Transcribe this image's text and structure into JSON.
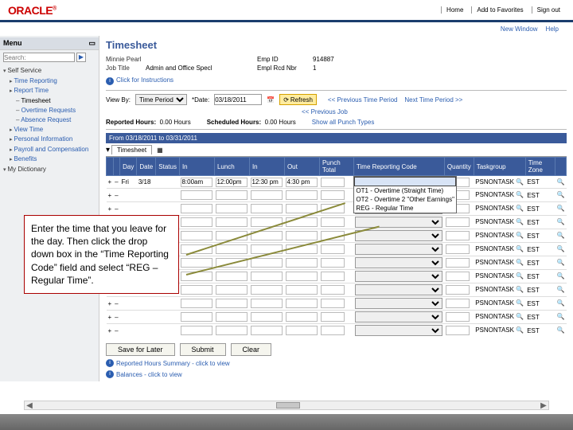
{
  "brand": "ORACLE",
  "top_links": [
    "Home",
    "Add to Favorites",
    "Sign out"
  ],
  "sub_header": {
    "new_window": "New Window",
    "help": "Help"
  },
  "sidebar": {
    "menu_label": "Menu",
    "search_placeholder": "Search:",
    "items": [
      {
        "cls": "lvl0",
        "t": "Self Service"
      },
      {
        "cls": "lvl1",
        "t": "Time Reporting"
      },
      {
        "cls": "lvl1",
        "t": "Report Time"
      },
      {
        "cls": "lvl2 active",
        "t": "Timesheet"
      },
      {
        "cls": "lvl2",
        "t": "Overtime Requests"
      },
      {
        "cls": "lvl2",
        "t": "Absence Request"
      },
      {
        "cls": "lvl1",
        "t": "View Time"
      },
      {
        "cls": "lvl1",
        "t": "Personal Information"
      },
      {
        "cls": "lvl1",
        "t": "Payroll and Compensation"
      },
      {
        "cls": "lvl1",
        "t": "Benefits"
      },
      {
        "cls": "lvl0",
        "t": "My Dictionary"
      }
    ]
  },
  "page": {
    "title": "Timesheet",
    "name": "Minnie Pearl",
    "job_title_lbl": "Job Title",
    "job_title": "Admin and Office Specl",
    "emp_id_lbl": "Emp ID",
    "emp_id": "914887",
    "emp_rcd_lbl": "Empl Rcd Nbr",
    "emp_rcd": "1",
    "instr": "Click for Instructions",
    "view_by_lbl": "View By:",
    "view_by": "Time Period",
    "date_lbl": "*Date:",
    "date": "03/18/2011",
    "refresh": "Refresh",
    "prev_period": "<< Previous Time Period",
    "next_period": "Next Time Period >>",
    "prev_job": "<< Previous Job",
    "rep_hours_lbl": "Reported Hours:",
    "rep_hours": "0.00 Hours",
    "sched_hours_lbl": "Scheduled Hours:",
    "sched_hours": "0.00 Hours",
    "show_all": "Show all Punch Types",
    "band": "From 03/18/2011 to 03/31/2011",
    "tab": "Timesheet",
    "cols": [
      "",
      "",
      "Day",
      "Date",
      "Status",
      "In",
      "Lunch",
      "In",
      "Out",
      "Punch Total",
      "Time Reporting Code",
      "Quantity",
      "Taskgroup",
      "Time Zone",
      ""
    ],
    "rows": [
      {
        "plus": "+",
        "minus": "–",
        "day": "Fri",
        "date": "3/18",
        "status": "",
        "in": "8:00am",
        "lunch": "12:00pm",
        "in2": "12:30 pm",
        "out": "4:30 pm",
        "pt": "",
        "tg": "PSNONTASK",
        "tz": "EST",
        "open": true
      },
      {
        "plus": "+",
        "minus": "–",
        "day": "",
        "date": "",
        "status": "",
        "in": "",
        "lunch": "",
        "in2": "",
        "out": "",
        "pt": "",
        "tg": "PSNONTASK",
        "tz": "EST"
      },
      {
        "plus": "+",
        "minus": "–",
        "day": "",
        "date": "",
        "status": "",
        "in": "",
        "lunch": "",
        "in2": "",
        "out": "",
        "pt": "",
        "tg": "PSNONTASK",
        "tz": "EST"
      },
      {
        "plus": "+",
        "minus": "–",
        "day": "",
        "date": "",
        "status": "",
        "in": "",
        "lunch": "",
        "in2": "",
        "out": "",
        "pt": "",
        "tg": "PSNONTASK",
        "tz": "EST"
      },
      {
        "plus": "+",
        "minus": "–",
        "day": "",
        "date": "",
        "status": "",
        "in": "",
        "lunch": "",
        "in2": "",
        "out": "",
        "pt": "",
        "tg": "PSNONTASK",
        "tz": "EST"
      },
      {
        "plus": "+",
        "minus": "–",
        "day": "",
        "date": "",
        "status": "",
        "in": "",
        "lunch": "",
        "in2": "",
        "out": "",
        "pt": "",
        "tg": "PSNONTASK",
        "tz": "EST"
      },
      {
        "plus": "+",
        "minus": "–",
        "day": "",
        "date": "",
        "status": "",
        "in": "",
        "lunch": "",
        "in2": "",
        "out": "",
        "pt": "",
        "tg": "PSNONTASK",
        "tz": "EST"
      },
      {
        "plus": "+",
        "minus": "–",
        "day": "",
        "date": "",
        "status": "",
        "in": "",
        "lunch": "",
        "in2": "",
        "out": "",
        "pt": "",
        "tg": "PSNONTASK",
        "tz": "EST"
      },
      {
        "plus": "+",
        "minus": "–",
        "day": "",
        "date": "",
        "status": "",
        "in": "",
        "lunch": "",
        "in2": "",
        "out": "",
        "pt": "",
        "tg": "PSNONTASK",
        "tz": "EST"
      },
      {
        "plus": "+",
        "minus": "–",
        "day": "",
        "date": "",
        "status": "",
        "in": "",
        "lunch": "",
        "in2": "",
        "out": "",
        "pt": "",
        "tg": "PSNONTASK",
        "tz": "EST"
      },
      {
        "plus": "+",
        "minus": "–",
        "day": "",
        "date": "",
        "status": "",
        "in": "",
        "lunch": "",
        "in2": "",
        "out": "",
        "pt": "",
        "tg": "PSNONTASK",
        "tz": "EST"
      },
      {
        "plus": "+",
        "minus": "–",
        "day": "",
        "date": "",
        "status": "",
        "in": "",
        "lunch": "",
        "in2": "",
        "out": "",
        "pt": "",
        "tg": "PSNONTASK",
        "tz": "EST"
      }
    ],
    "dropdown_options": [
      "OT1 - Overtime (Straight Time)",
      "OT2 - Overtime 2 \"Other Earnings\"",
      "REG - Regular Time"
    ],
    "btn_save": "Save for Later",
    "btn_submit": "Submit",
    "btn_clear": "Clear",
    "foot1": "Reported Hours Summary - click to view",
    "foot2": "Balances - click to view",
    "lookup_label": "Lookup"
  },
  "callout": "Enter the time that you leave for the day. Then click the drop down box in the “Time Reporting Code” field and select “REG – Regular Time”."
}
